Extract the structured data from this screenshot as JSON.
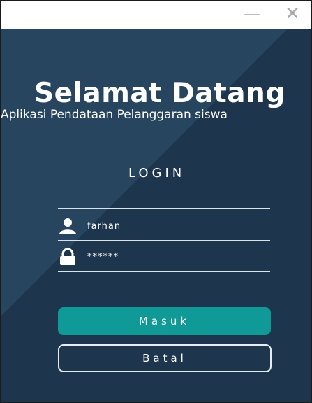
{
  "window": {
    "minimize_glyph": "—",
    "close_glyph": "✕"
  },
  "header": {
    "title": "Selamat Datang",
    "subtitle": "Aplikasi Pendataan Pelanggaran siswa"
  },
  "login": {
    "heading": "LOGIN",
    "username_value": "farhan",
    "password_value": "******",
    "submit_label": "Masuk",
    "cancel_label": "Batal"
  },
  "colors": {
    "background": "#1f3a52",
    "accent": "#0f9a98",
    "text": "#ffffff"
  },
  "icons": {
    "username": "user-icon",
    "password": "lock-icon"
  }
}
